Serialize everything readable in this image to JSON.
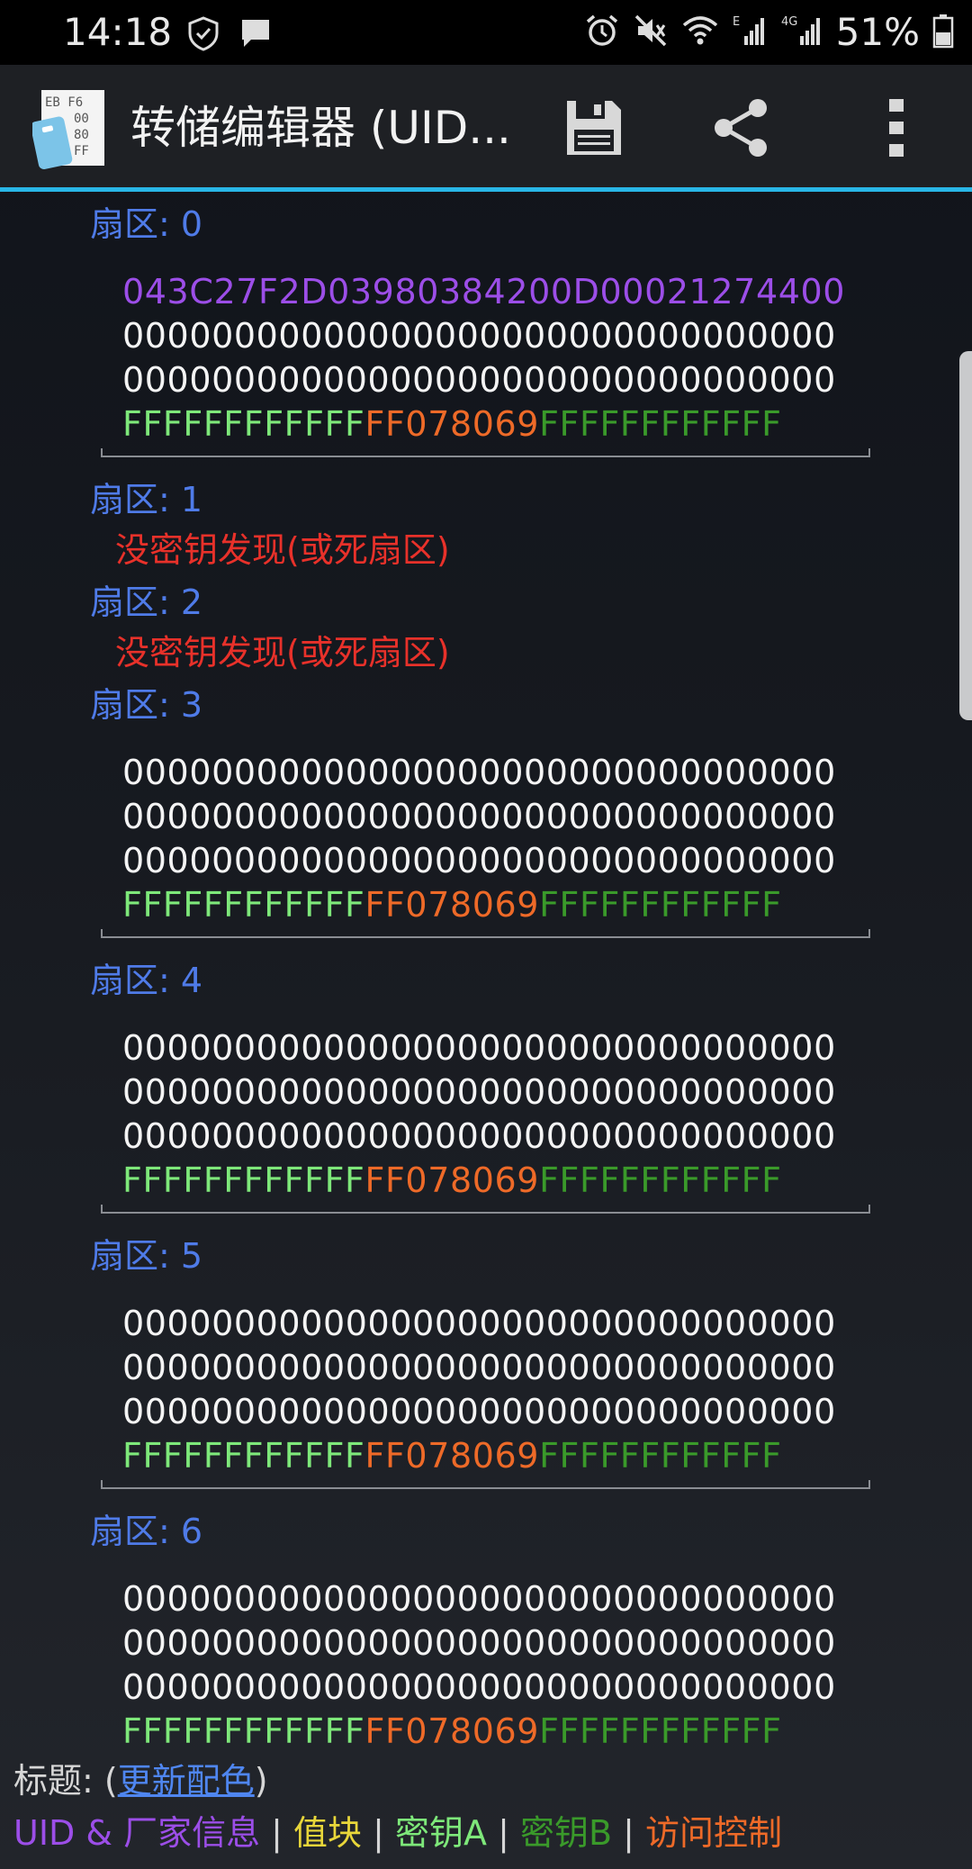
{
  "status_bar": {
    "time": "14:18",
    "left_icons": [
      "shield-check-icon",
      "message-icon"
    ],
    "right_icons": [
      "alarm-icon",
      "mute-icon",
      "wifi-icon",
      "signal-e-icon",
      "signal-4g-icon"
    ],
    "network_e": "E",
    "network_4g": "4G",
    "battery_text": "51%",
    "battery_level": 0.51
  },
  "toolbar": {
    "app_icon_text": [
      "EB F6",
      "00",
      "80",
      "FF"
    ],
    "title": "转储编辑器 (UID...",
    "save_icon": "save-icon",
    "share_icon": "share-icon",
    "more_icon": "more-vertical-icon"
  },
  "sectors": [
    {
      "label": "扇区: 0",
      "blocks": [
        {
          "kind": "uid",
          "text": "043C27F2D03980384200D00021274400"
        },
        {
          "kind": "value",
          "text": "00000000000000000000000000000000"
        },
        {
          "kind": "value",
          "text": "00000000000000000000000000000000"
        },
        {
          "kind": "trailer",
          "key_a": "FFFFFFFFFFFF",
          "access": "FF078069",
          "key_b": "FFFFFFFFFFFF"
        }
      ]
    },
    {
      "label": "扇区: 1",
      "error": "没密钥发现(或死扇区)"
    },
    {
      "label": "扇区: 2",
      "error": "没密钥发现(或死扇区)"
    },
    {
      "label": "扇区: 3",
      "blocks": [
        {
          "kind": "value",
          "text": "00000000000000000000000000000000"
        },
        {
          "kind": "value",
          "text": "00000000000000000000000000000000"
        },
        {
          "kind": "value",
          "text": "00000000000000000000000000000000"
        },
        {
          "kind": "trailer",
          "key_a": "FFFFFFFFFFFF",
          "access": "FF078069",
          "key_b": "FFFFFFFFFFFF"
        }
      ]
    },
    {
      "label": "扇区: 4",
      "blocks": [
        {
          "kind": "value",
          "text": "00000000000000000000000000000000"
        },
        {
          "kind": "value",
          "text": "00000000000000000000000000000000"
        },
        {
          "kind": "value",
          "text": "00000000000000000000000000000000"
        },
        {
          "kind": "trailer",
          "key_a": "FFFFFFFFFFFF",
          "access": "FF078069",
          "key_b": "FFFFFFFFFFFF"
        }
      ]
    },
    {
      "label": "扇区: 5",
      "blocks": [
        {
          "kind": "value",
          "text": "00000000000000000000000000000000"
        },
        {
          "kind": "value",
          "text": "00000000000000000000000000000000"
        },
        {
          "kind": "value",
          "text": "00000000000000000000000000000000"
        },
        {
          "kind": "trailer",
          "key_a": "FFFFFFFFFFFF",
          "access": "FF078069",
          "key_b": "FFFFFFFFFFFF"
        }
      ]
    },
    {
      "label": "扇区: 6",
      "blocks": [
        {
          "kind": "value",
          "text": "00000000000000000000000000000000"
        },
        {
          "kind": "value",
          "text": "00000000000000000000000000000000"
        },
        {
          "kind": "value",
          "text": "00000000000000000000000000000000"
        },
        {
          "kind": "trailer",
          "key_a": "FFFFFFFFFFFF",
          "access": "FF078069",
          "key_b": "FFFFFFFFFFFF"
        }
      ]
    }
  ],
  "legend": {
    "title_prefix": "标题: (",
    "update_link": "更新配色",
    "title_suffix": ")",
    "uid_label": "UID & 厂家信息",
    "value_label": "值块",
    "key_a_label": "密钥A",
    "key_b_label": "密钥B",
    "access_label": "访问控制",
    "separator": " | "
  },
  "colors": {
    "accent": "#29b6e6",
    "sector_header": "#4f7be8",
    "error": "#e8312a",
    "uid": "#9c4ee8",
    "value_block": "#e8d63a",
    "key_a": "#7ee87a",
    "access_conditions": "#ee6a28",
    "key_b": "#3a9a2a"
  }
}
